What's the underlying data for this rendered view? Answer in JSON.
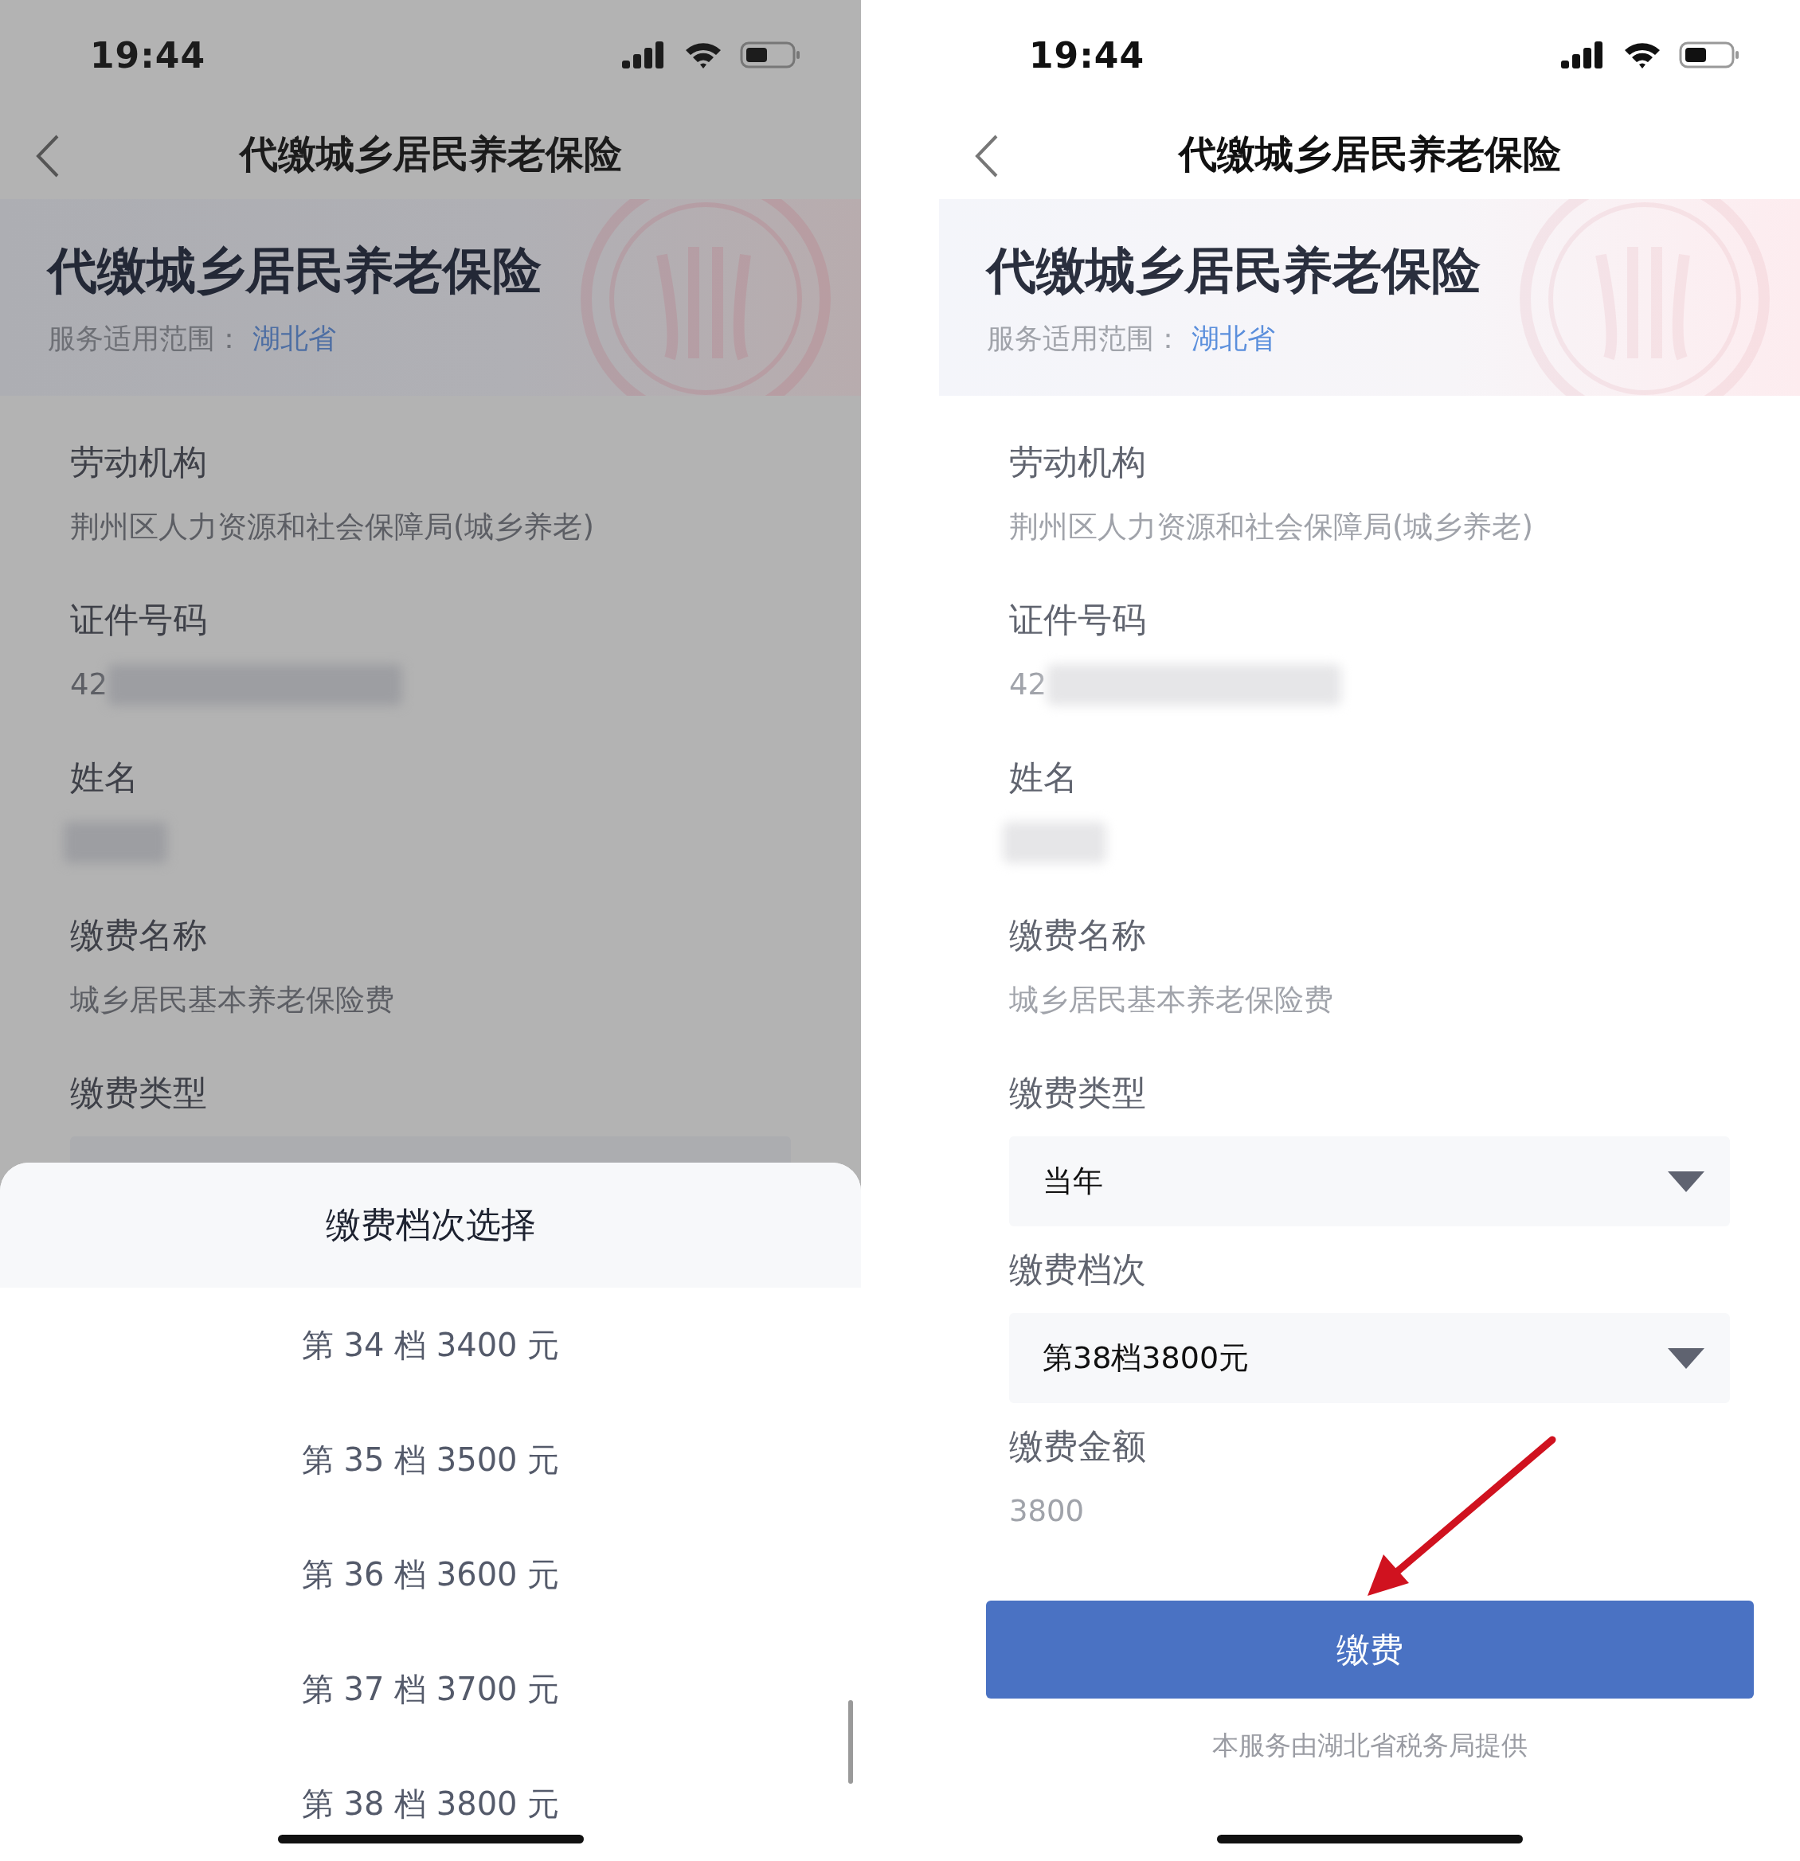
{
  "screens": [
    {
      "dimmed": true,
      "status_bar": {
        "time": "19:44"
      },
      "nav": {
        "title": "代缴城乡居民养老保险"
      },
      "banner": {
        "title": "代缴城乡居民养老保险",
        "scope_label": "服务适用范围：",
        "scope_value": "湖北省"
      },
      "fields": [
        {
          "kind": "text",
          "label": "劳动机构",
          "value": "荆州区人力资源和社会保障局(城乡养老)"
        },
        {
          "kind": "redacted",
          "label": "证件号码",
          "value": "42"
        },
        {
          "kind": "redacted",
          "label": "姓名"
        },
        {
          "kind": "text",
          "label": "缴费名称",
          "value": "城乡居民基本养老保险费"
        },
        {
          "kind": "select",
          "label": "缴费类型"
        }
      ],
      "sheet": {
        "title": "缴费档次选择",
        "options": [
          "第 34 档 3400 元",
          "第 35 档 3500 元",
          "第 36 档 3600 元",
          "第 37 档 3700 元",
          "第 38 档 3800 元"
        ]
      }
    },
    {
      "dimmed": false,
      "status_bar": {
        "time": "19:44"
      },
      "nav": {
        "title": "代缴城乡居民养老保险"
      },
      "banner": {
        "title": "代缴城乡居民养老保险",
        "scope_label": "服务适用范围：",
        "scope_value": "湖北省"
      },
      "fields": [
        {
          "kind": "text",
          "label": "劳动机构",
          "value": "荆州区人力资源和社会保障局(城乡养老)"
        },
        {
          "kind": "redacted",
          "label": "证件号码",
          "value": "42"
        },
        {
          "kind": "redacted",
          "label": "姓名"
        },
        {
          "kind": "text",
          "label": "缴费名称",
          "value": "城乡居民基本养老保险费"
        },
        {
          "kind": "select",
          "label": "缴费类型",
          "value": "当年"
        },
        {
          "kind": "select",
          "label": "缴费档次",
          "value": "第38档3800元"
        },
        {
          "kind": "text",
          "label": "缴费金额",
          "value": "3800"
        }
      ],
      "button": "缴费",
      "footer": "本服务由湖北省税务局提供",
      "annotation_arrow": true
    }
  ]
}
